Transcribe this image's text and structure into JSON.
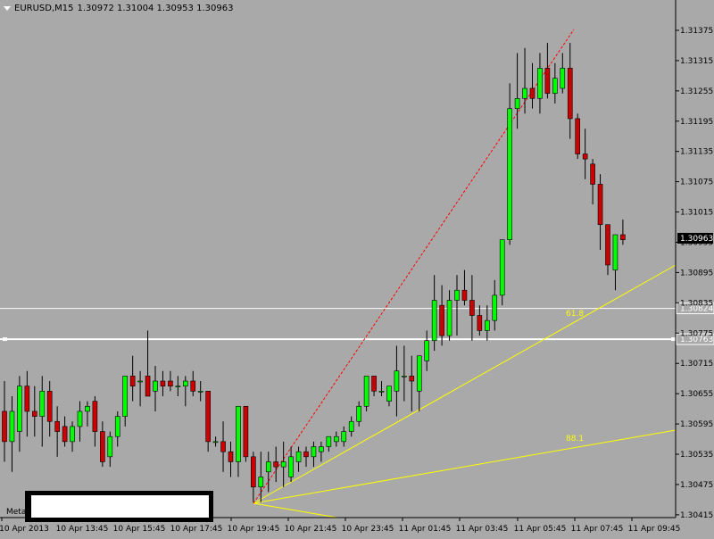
{
  "header": {
    "symbol": "EURUSD,M15",
    "ohlc": "1.30972 1.31004 1.30953 1.30963"
  },
  "meta_label": "Meta",
  "colors": {
    "background": "#a9a9a9",
    "bull": "#00ff00",
    "bear": "#cc0000",
    "wick": "#000000",
    "fib": "#ffff00",
    "trend": "#ff0000",
    "hline": "#ffffff",
    "axis_text": "#000000"
  },
  "chart_data": {
    "type": "candlestick",
    "symbol": "EURUSD",
    "timeframe": "M15",
    "ylim": [
      1.30413,
      1.31428
    ],
    "y_ticks": [
      "1.31375",
      "1.31315",
      "1.31255",
      "1.31195",
      "1.31135",
      "1.31075",
      "1.31015",
      "1.30955",
      "1.30895",
      "1.30835",
      "1.30775",
      "1.30715",
      "1.30655",
      "1.30595",
      "1.30535",
      "1.30475",
      "1.30415"
    ],
    "x_ticks": [
      "10 Apr 2013",
      "10 Apr 13:45",
      "10 Apr 15:45",
      "10 Apr 17:45",
      "10 Apr 19:45",
      "10 Apr 21:45",
      "10 Apr 23:45",
      "11 Apr 01:45",
      "11 Apr 03:45",
      "11 Apr 05:45",
      "11 Apr 07:45",
      "11 Apr 09:45"
    ],
    "current_price": "1.30963",
    "hlines": [
      {
        "price": 1.30824,
        "label": "1.30824"
      },
      {
        "price": 1.30763,
        "label": "1.30763"
      }
    ],
    "fib_labels": [
      "61.8",
      "88.1"
    ],
    "candles": [
      {
        "o": 1.3062,
        "h": 1.3068,
        "l": 1.3052,
        "c": 1.3056
      },
      {
        "o": 1.3056,
        "h": 1.3065,
        "l": 1.305,
        "c": 1.3062
      },
      {
        "o": 1.3058,
        "h": 1.3069,
        "l": 1.3054,
        "c": 1.3067
      },
      {
        "o": 1.3067,
        "h": 1.307,
        "l": 1.3057,
        "c": 1.3062
      },
      {
        "o": 1.3062,
        "h": 1.3067,
        "l": 1.3057,
        "c": 1.3061
      },
      {
        "o": 1.3061,
        "h": 1.3069,
        "l": 1.3055,
        "c": 1.3066
      },
      {
        "o": 1.3066,
        "h": 1.3068,
        "l": 1.3057,
        "c": 1.306
      },
      {
        "o": 1.306,
        "h": 1.3063,
        "l": 1.3053,
        "c": 1.3058
      },
      {
        "o": 1.3059,
        "h": 1.3061,
        "l": 1.3055,
        "c": 1.3056
      },
      {
        "o": 1.3056,
        "h": 1.306,
        "l": 1.3054,
        "c": 1.3059
      },
      {
        "o": 1.3059,
        "h": 1.3064,
        "l": 1.3056,
        "c": 1.3062
      },
      {
        "o": 1.3062,
        "h": 1.3064,
        "l": 1.3059,
        "c": 1.3063
      },
      {
        "o": 1.3064,
        "h": 1.3065,
        "l": 1.3055,
        "c": 1.3058
      },
      {
        "o": 1.3058,
        "h": 1.306,
        "l": 1.3051,
        "c": 1.3052
      },
      {
        "o": 1.3053,
        "h": 1.3058,
        "l": 1.3051,
        "c": 1.3057
      },
      {
        "o": 1.3057,
        "h": 1.3062,
        "l": 1.3055,
        "c": 1.3061
      },
      {
        "o": 1.3061,
        "h": 1.3069,
        "l": 1.3059,
        "c": 1.3069
      },
      {
        "o": 1.3069,
        "h": 1.3073,
        "l": 1.3064,
        "c": 1.3067
      },
      {
        "o": 1.3068,
        "h": 1.307,
        "l": 1.3063,
        "c": 1.3068
      },
      {
        "o": 1.3069,
        "h": 1.3078,
        "l": 1.3066,
        "c": 1.3065
      },
      {
        "o": 1.3066,
        "h": 1.3071,
        "l": 1.3062,
        "c": 1.3068
      },
      {
        "o": 1.3068,
        "h": 1.307,
        "l": 1.3065,
        "c": 1.3067
      },
      {
        "o": 1.3068,
        "h": 1.307,
        "l": 1.3066,
        "c": 1.3067
      },
      {
        "o": 1.3067,
        "h": 1.3069,
        "l": 1.3065,
        "c": 1.3067
      },
      {
        "o": 1.3067,
        "h": 1.3069,
        "l": 1.3063,
        "c": 1.3068
      },
      {
        "o": 1.3068,
        "h": 1.307,
        "l": 1.3065,
        "c": 1.3066
      },
      {
        "o": 1.3066,
        "h": 1.3068,
        "l": 1.3064,
        "c": 1.3066
      },
      {
        "o": 1.3066,
        "h": 1.3066,
        "l": 1.3054,
        "c": 1.3056
      },
      {
        "o": 1.3056,
        "h": 1.3057,
        "l": 1.3055,
        "c": 1.3056
      },
      {
        "o": 1.3056,
        "h": 1.306,
        "l": 1.305,
        "c": 1.3054
      },
      {
        "o": 1.3054,
        "h": 1.3056,
        "l": 1.3049,
        "c": 1.3052
      },
      {
        "o": 1.3052,
        "h": 1.3063,
        "l": 1.3049,
        "c": 1.3063
      },
      {
        "o": 1.3063,
        "h": 1.3063,
        "l": 1.3052,
        "c": 1.3053
      },
      {
        "o": 1.3053,
        "h": 1.3054,
        "l": 1.3044,
        "c": 1.3047
      },
      {
        "o": 1.3047,
        "h": 1.3054,
        "l": 1.3044,
        "c": 1.3049
      },
      {
        "o": 1.305,
        "h": 1.3054,
        "l": 1.3046,
        "c": 1.3052
      },
      {
        "o": 1.3052,
        "h": 1.3055,
        "l": 1.3048,
        "c": 1.3051
      },
      {
        "o": 1.3051,
        "h": 1.3056,
        "l": 1.3047,
        "c": 1.3052
      },
      {
        "o": 1.3049,
        "h": 1.3055,
        "l": 1.3048,
        "c": 1.3053
      },
      {
        "o": 1.3052,
        "h": 1.3055,
        "l": 1.305,
        "c": 1.3054
      },
      {
        "o": 1.3054,
        "h": 1.3055,
        "l": 1.3051,
        "c": 1.3053
      },
      {
        "o": 1.3053,
        "h": 1.3056,
        "l": 1.3051,
        "c": 1.3055
      },
      {
        "o": 1.3054,
        "h": 1.3056,
        "l": 1.3052,
        "c": 1.3055
      },
      {
        "o": 1.3055,
        "h": 1.3057,
        "l": 1.3054,
        "c": 1.3057
      },
      {
        "o": 1.3056,
        "h": 1.3058,
        "l": 1.3055,
        "c": 1.3057
      },
      {
        "o": 1.3056,
        "h": 1.3059,
        "l": 1.3055,
        "c": 1.3058
      },
      {
        "o": 1.3058,
        "h": 1.3061,
        "l": 1.3057,
        "c": 1.306
      },
      {
        "o": 1.306,
        "h": 1.3064,
        "l": 1.3059,
        "c": 1.3063
      },
      {
        "o": 1.3063,
        "h": 1.3069,
        "l": 1.3062,
        "c": 1.3069
      },
      {
        "o": 1.3069,
        "h": 1.3069,
        "l": 1.3065,
        "c": 1.3066
      },
      {
        "o": 1.3066,
        "h": 1.3068,
        "l": 1.3065,
        "c": 1.3066
      },
      {
        "o": 1.3064,
        "h": 1.3067,
        "l": 1.3063,
        "c": 1.3067
      },
      {
        "o": 1.3066,
        "h": 1.3075,
        "l": 1.3061,
        "c": 1.307
      },
      {
        "o": 1.3069,
        "h": 1.3075,
        "l": 1.3064,
        "c": 1.3069
      },
      {
        "o": 1.3069,
        "h": 1.3073,
        "l": 1.3062,
        "c": 1.3068
      },
      {
        "o": 1.3066,
        "h": 1.3072,
        "l": 1.3062,
        "c": 1.3073
      },
      {
        "o": 1.3072,
        "h": 1.3078,
        "l": 1.307,
        "c": 1.3076
      },
      {
        "o": 1.3076,
        "h": 1.3089,
        "l": 1.3074,
        "c": 1.3084
      },
      {
        "o": 1.3083,
        "h": 1.3087,
        "l": 1.3075,
        "c": 1.3077
      },
      {
        "o": 1.3077,
        "h": 1.3086,
        "l": 1.3076,
        "c": 1.3084
      },
      {
        "o": 1.3084,
        "h": 1.3089,
        "l": 1.3077,
        "c": 1.3086
      },
      {
        "o": 1.3086,
        "h": 1.309,
        "l": 1.3083,
        "c": 1.3084
      },
      {
        "o": 1.3084,
        "h": 1.3089,
        "l": 1.3076,
        "c": 1.3081
      },
      {
        "o": 1.3081,
        "h": 1.3083,
        "l": 1.3077,
        "c": 1.3078
      },
      {
        "o": 1.3078,
        "h": 1.3083,
        "l": 1.3076,
        "c": 1.308
      },
      {
        "o": 1.308,
        "h": 1.3088,
        "l": 1.3078,
        "c": 1.3085
      },
      {
        "o": 1.3085,
        "h": 1.3096,
        "l": 1.3083,
        "c": 1.3096
      },
      {
        "o": 1.3096,
        "h": 1.3127,
        "l": 1.3095,
        "c": 1.3122
      },
      {
        "o": 1.3122,
        "h": 1.3133,
        "l": 1.3118,
        "c": 1.3124
      },
      {
        "o": 1.3124,
        "h": 1.3134,
        "l": 1.3121,
        "c": 1.3126
      },
      {
        "o": 1.3126,
        "h": 1.3131,
        "l": 1.3122,
        "c": 1.3124
      },
      {
        "o": 1.3124,
        "h": 1.3133,
        "l": 1.3121,
        "c": 1.313
      },
      {
        "o": 1.313,
        "h": 1.3135,
        "l": 1.3124,
        "c": 1.3125
      },
      {
        "o": 1.3125,
        "h": 1.3131,
        "l": 1.3123,
        "c": 1.3128
      },
      {
        "o": 1.3126,
        "h": 1.3133,
        "l": 1.3125,
        "c": 1.313
      },
      {
        "o": 1.313,
        "h": 1.3135,
        "l": 1.3116,
        "c": 1.312
      },
      {
        "o": 1.312,
        "h": 1.3121,
        "l": 1.3112,
        "c": 1.3113
      },
      {
        "o": 1.3113,
        "h": 1.3118,
        "l": 1.3108,
        "c": 1.3112
      },
      {
        "o": 1.3111,
        "h": 1.3112,
        "l": 1.3103,
        "c": 1.3107
      },
      {
        "o": 1.3107,
        "h": 1.3109,
        "l": 1.3094,
        "c": 1.3099
      },
      {
        "o": 1.3099,
        "h": 1.3099,
        "l": 1.3089,
        "c": 1.3091
      },
      {
        "o": 1.309,
        "h": 1.3097,
        "l": 1.3086,
        "c": 1.3097
      },
      {
        "o": 1.3097,
        "h": 1.31,
        "l": 1.3095,
        "c": 1.3096
      }
    ]
  }
}
